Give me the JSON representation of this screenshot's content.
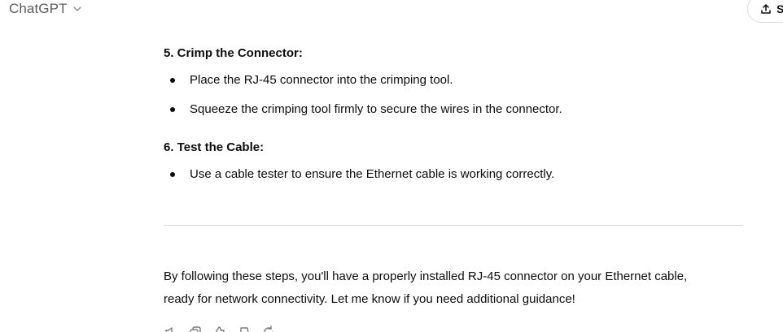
{
  "header": {
    "model_name": "ChatGPT",
    "share_label": "S"
  },
  "message": {
    "sections": [
      {
        "heading": "5. Crimp the Connector:",
        "bullets": [
          "Place the RJ-45 connector into the crimping tool.",
          "Squeeze the crimping tool firmly to secure the wires in the connector."
        ]
      },
      {
        "heading": "6. Test the Cable:",
        "bullets": [
          "Use a cable tester to ensure the Ethernet cable is working correctly."
        ]
      }
    ],
    "closing_line1": "By following these steps, you'll have a properly installed RJ-45 connector on your Ethernet cable,",
    "closing_line2": "ready for network connectivity. Let me know if you need additional guidance!"
  },
  "action_icons": [
    "read-aloud-icon",
    "copy-icon",
    "thumbs-up-icon",
    "thumbs-down-icon",
    "regenerate-icon"
  ]
}
